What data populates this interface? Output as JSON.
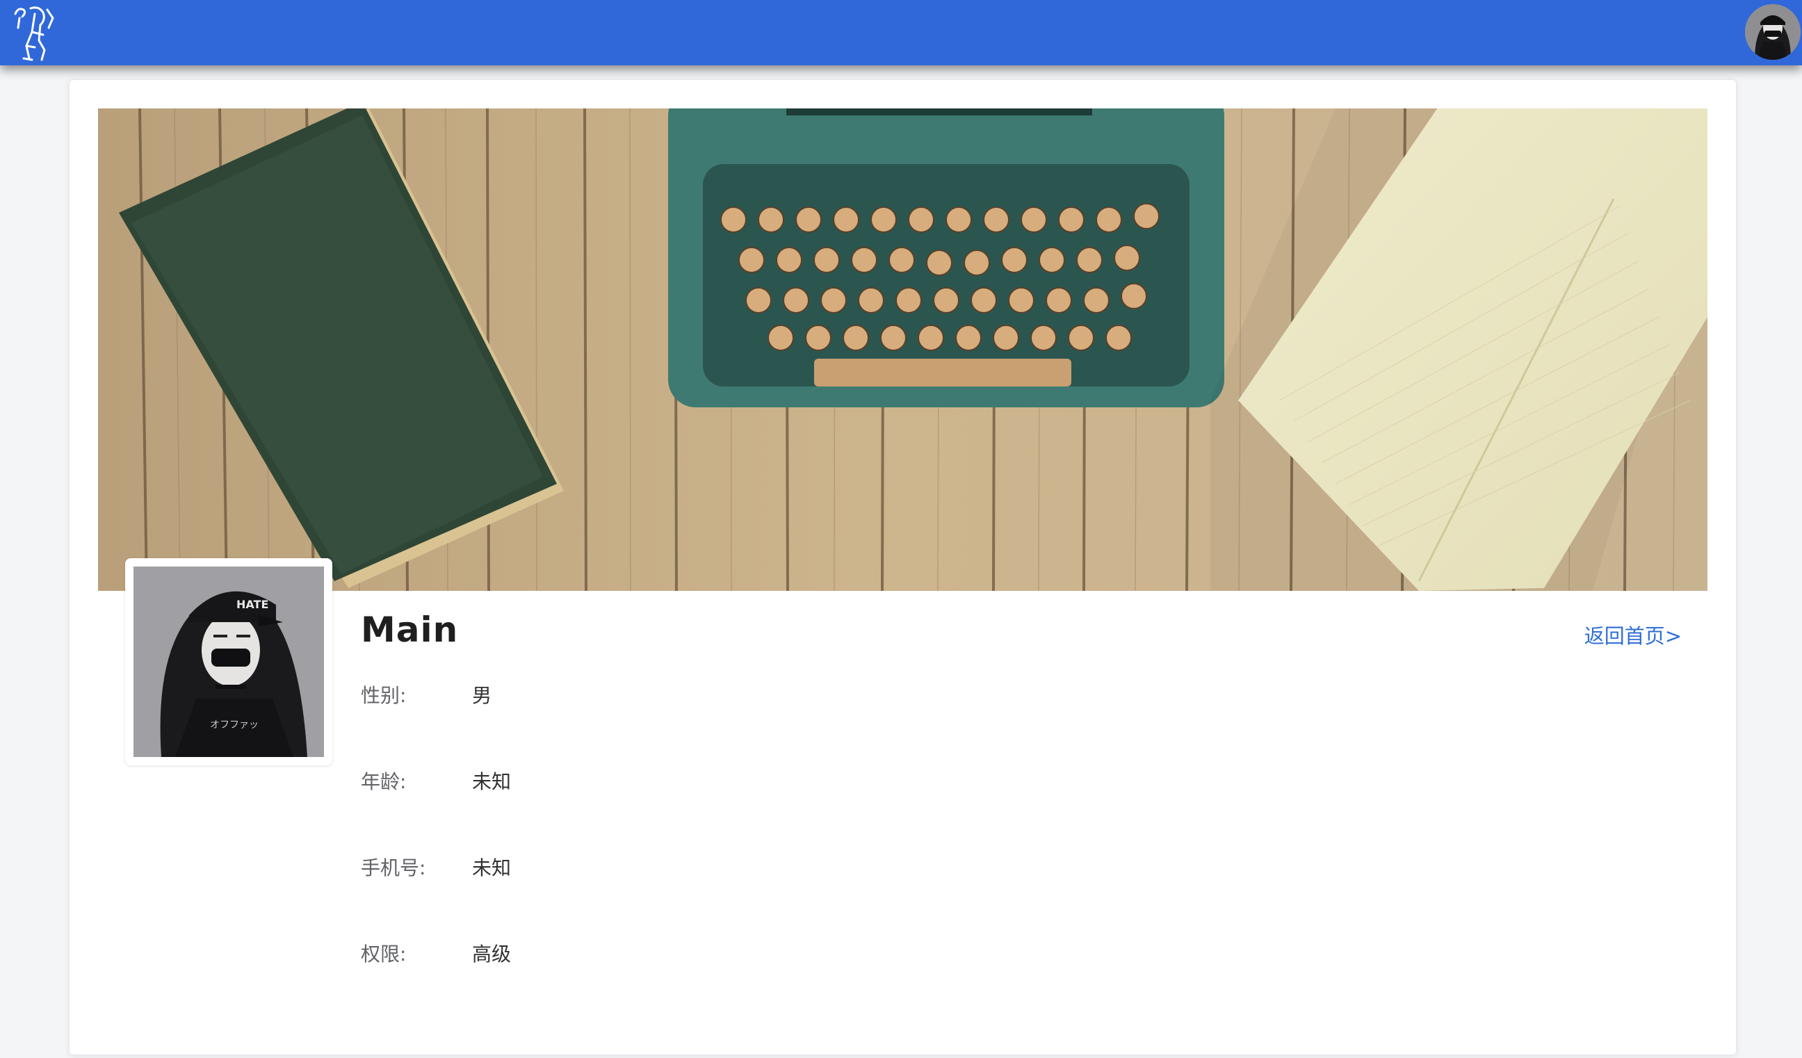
{
  "header": {
    "logo_icon": "sketch-figure-logo-icon",
    "avatar_icon": "masked-girl-avatar-icon",
    "background_color": "#3068d9"
  },
  "banner": {
    "image": "typewriter-book-notebook-on-wood-photo"
  },
  "profile": {
    "photo": "masked-girl-hate-cap-photo",
    "name": "Main",
    "back_link": "返回首页>",
    "fields": [
      {
        "label": "性别:",
        "value": "男"
      },
      {
        "label": "年龄:",
        "value": "未知"
      },
      {
        "label": "手机号:",
        "value": "未知"
      },
      {
        "label": "权限:",
        "value": "高级"
      }
    ]
  },
  "colors": {
    "link": "#2f6fd6",
    "label": "#606266",
    "value": "#303133"
  }
}
